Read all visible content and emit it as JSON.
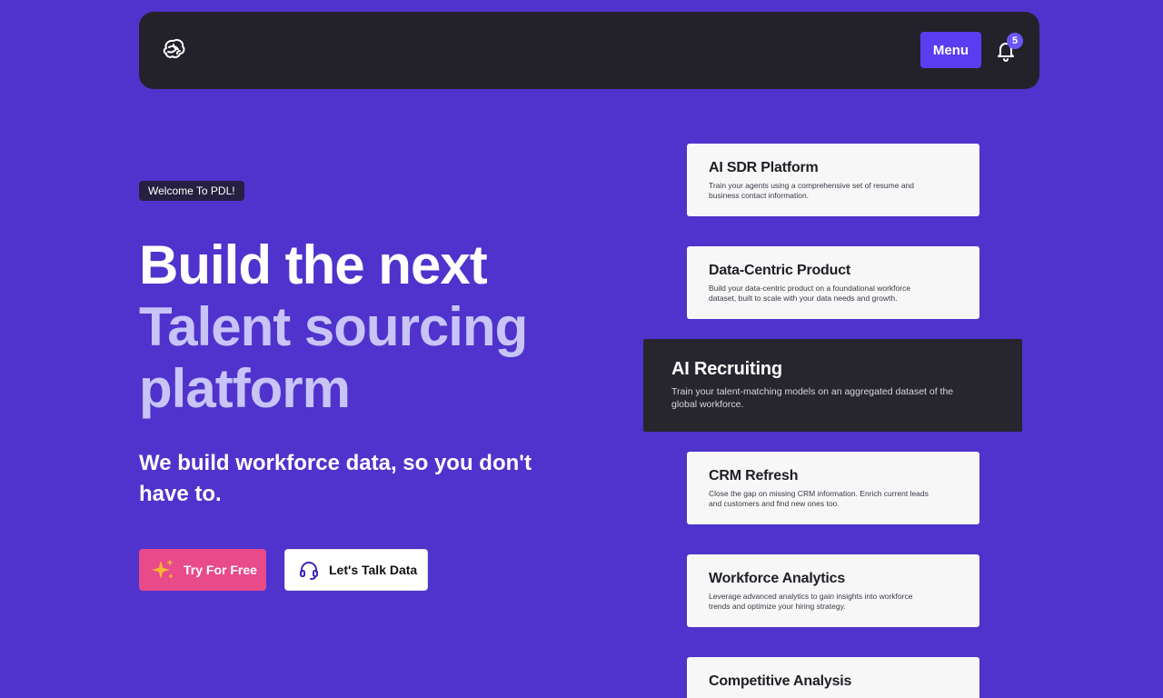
{
  "nav": {
    "logo": "brain-logo",
    "menu_label": "Menu",
    "notification_count": "5"
  },
  "hero": {
    "badge": "Welcome To PDL!",
    "headline_line1": "Build the next",
    "headline_line2": "Talent sourcing",
    "headline_line3": "platform",
    "subheadline": "We build workforce data, so you don't have to.",
    "cta_primary": "Try For Free",
    "cta_secondary": "Let's Talk Data"
  },
  "cards": [
    {
      "title": "AI SDR Platform",
      "description": "Train your agents using a comprehensive set of resume and business contact information."
    },
    {
      "title": "Data-Centric Product",
      "description": "Build your data-centric product on a foundational workforce dataset, built to scale with your data needs and growth."
    },
    {
      "title": "AI Recruiting",
      "description": "Train your talent-matching models on an aggregated dataset of the global workforce."
    },
    {
      "title": "CRM Refresh",
      "description": "Close the gap on missing CRM information. Enrich current leads and customers and find new ones too."
    },
    {
      "title": "Workforce Analytics",
      "description": "Leverage advanced analytics to gain insights into workforce trends and optimize your hiring strategy."
    },
    {
      "title": "Competitive Analysis",
      "description": ""
    }
  ],
  "colors": {
    "background": "#4f33cc",
    "navbar": "#23222a",
    "menu_button": "#5a3df0",
    "accent_lilac": "#c8c4f8",
    "cta_pink": "#e84a8a",
    "feature_card": "#27252e"
  }
}
